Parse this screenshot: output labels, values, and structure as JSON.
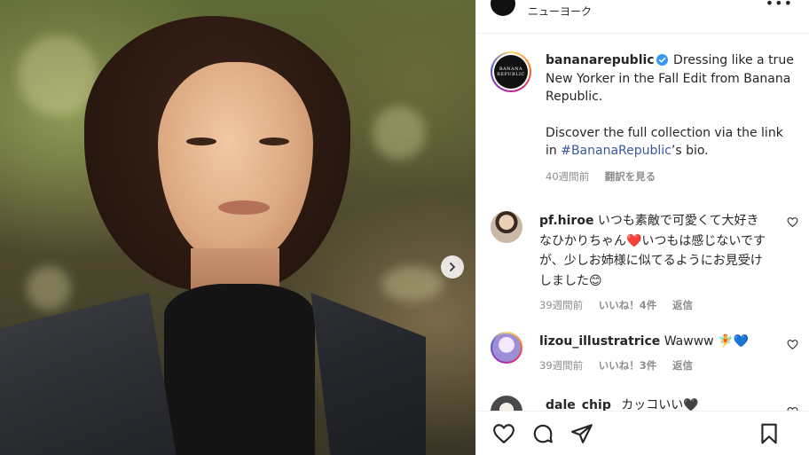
{
  "header": {
    "location": "ニューヨーク",
    "more_icon": "more-horizontal-icon"
  },
  "caption": {
    "username": "bananarepublic",
    "logo_text_1": "BANANA",
    "logo_text_2": "REPUBLIC",
    "verified_icon": "verified-badge-icon",
    "text_1": " Dressing like a true New Yorker in the Fall Edit from Banana Republic.",
    "text_2": "Discover the full collection via the link in ",
    "hashtag": "#BananaRepublic",
    "text_3": "’s bio.",
    "time": "40週間前",
    "translate": "翻訳を見る"
  },
  "comments": [
    {
      "username": "pf.hiroe",
      "text": " いつも素敵で可愛くて大好きなひかりちゃん❤️いつもは感じないですが、少しお姉様に似てるようにお見受けしました😊",
      "time": "39週間前",
      "likes": "いいね！4件",
      "reply": "返信"
    },
    {
      "username": "lizou_illustratrice",
      "text": " Wawww 🧚💙",
      "time": "39週間前",
      "likes": "いいね！3件",
      "reply": "返信"
    },
    {
      "username": "_dale_chip_",
      "text": " カッコいい🖤"
    }
  ],
  "actions": {
    "like_icon": "heart-icon",
    "comment_icon": "comment-icon",
    "share_icon": "paper-plane-icon",
    "save_icon": "bookmark-icon"
  },
  "colors": {
    "hashtag": "#385898",
    "muted": "#8e8e8e",
    "verified": "#3897f0"
  }
}
